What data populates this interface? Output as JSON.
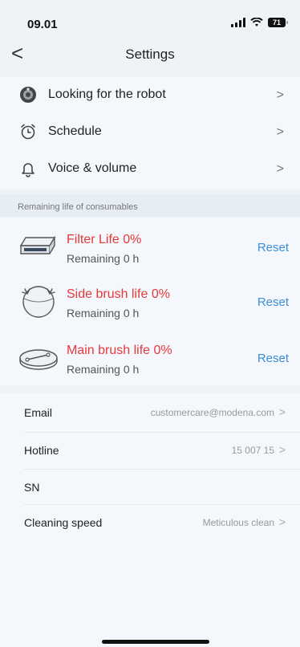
{
  "status": {
    "time": "09.01",
    "battery": "71"
  },
  "nav": {
    "back": "<",
    "title": "Settings"
  },
  "menu": [
    {
      "label": "Looking for the robot",
      "icon": "robot-icon",
      "chevron": ">"
    },
    {
      "label": "Schedule",
      "icon": "alarm-clock-icon",
      "chevron": ">"
    },
    {
      "label": "Voice & volume",
      "icon": "bell-icon",
      "chevron": ">"
    }
  ],
  "consumables": {
    "header": "Remaining life of consumables",
    "items": [
      {
        "title": "Filter Life 0%",
        "remaining": "Remaining 0 h",
        "reset": "Reset",
        "icon": "filter-icon"
      },
      {
        "title": "Side brush life 0%",
        "remaining": "Remaining 0 h",
        "reset": "Reset",
        "icon": "side-brush-icon"
      },
      {
        "title": "Main brush life 0%",
        "remaining": "Remaining 0 h",
        "reset": "Reset",
        "icon": "main-brush-icon"
      }
    ]
  },
  "info": [
    {
      "label": "Email",
      "value": "customercare@modena.com",
      "arrow": ">"
    },
    {
      "label": "Hotline",
      "value": "15 007 15",
      "arrow": ">"
    },
    {
      "label": "SN",
      "value": ""
    },
    {
      "label": "Cleaning speed",
      "value": "Meticulous clean",
      "arrow": ">"
    }
  ],
  "colors": {
    "accent": "#3b8fd9",
    "warning": "#e5393b",
    "background": "#eef3f8"
  }
}
